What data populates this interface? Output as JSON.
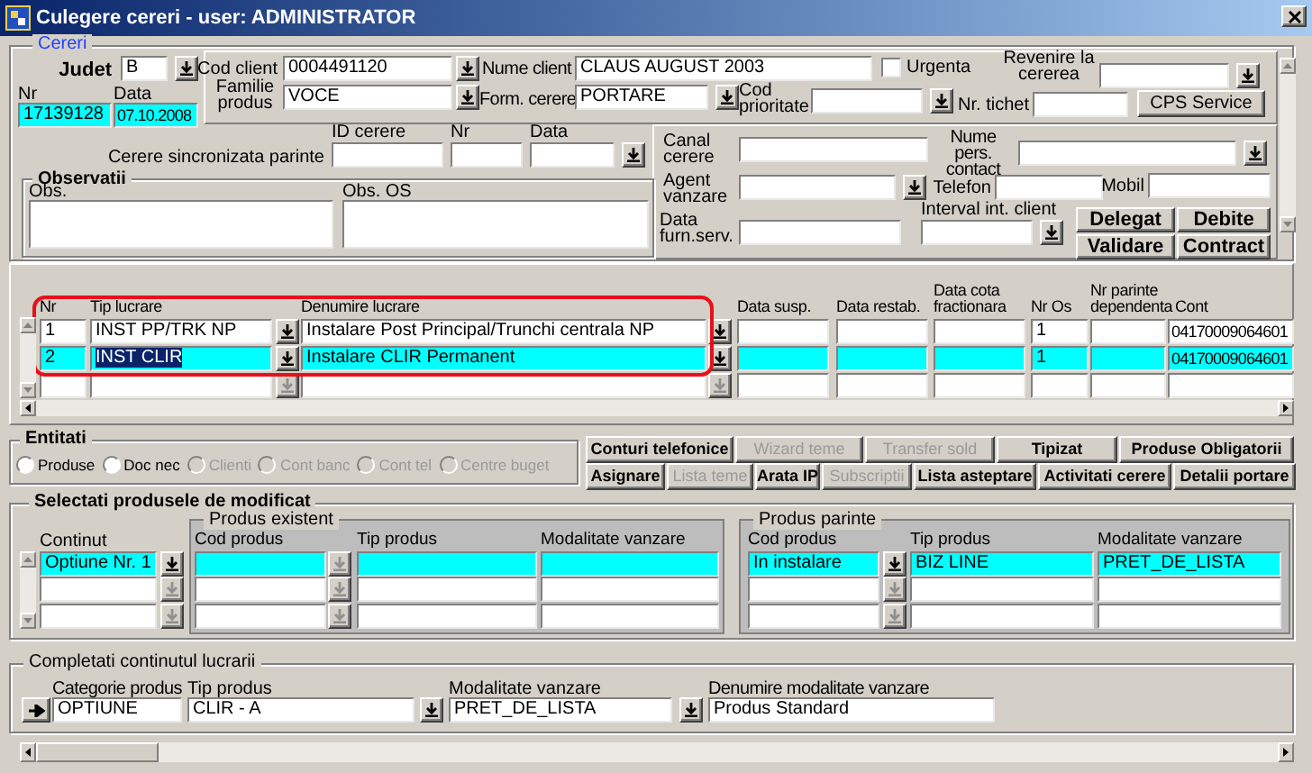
{
  "window": {
    "title": "Culegere cereri - user: ADMINISTRATOR"
  },
  "cereri": {
    "legend": "Cereri",
    "fields": [
      {
        "label": "Judet",
        "value": "B",
        "kind": "list",
        "highlighted": false
      },
      {
        "label": "Nr",
        "value": "17139128",
        "kind": "text",
        "highlighted": true
      },
      {
        "label": "Data",
        "value": "07.10.2008",
        "kind": "text",
        "highlighted": true
      },
      {
        "label": "Cod client",
        "value": "0004491120",
        "kind": "list",
        "highlighted": false
      },
      {
        "label": "Nume client",
        "value": "CLAUS AUGUST 2003",
        "kind": "text",
        "highlighted": false
      },
      {
        "label": "Revenire la cererea",
        "kind": "list",
        "highlighted": false
      },
      {
        "label": "Familie produs",
        "value": "VOCE",
        "kind": "list",
        "highlighted": false
      },
      {
        "label": "Form. cerere",
        "value": "PORTARE",
        "kind": "list",
        "highlighted": false
      },
      {
        "label": "Cod prioritate",
        "kind": "list",
        "highlighted": false
      },
      {
        "label": "Nr. tichet",
        "kind": "text",
        "highlighted": false
      },
      {
        "label": "ID cerere",
        "kind": "text",
        "highlighted": false
      },
      {
        "label": "Nr",
        "kind": "text",
        "highlighted": false
      },
      {
        "label": "Data",
        "kind": "list",
        "highlighted": false
      },
      {
        "label": "Canal cerere",
        "kind": "text",
        "highlighted": false
      },
      {
        "label": "Nume pers. contact",
        "kind": "list",
        "highlighted": false
      },
      {
        "label": "Agent vanzare",
        "kind": "list",
        "highlighted": false
      },
      {
        "label": "Telefon",
        "kind": "text",
        "highlighted": false
      },
      {
        "label": "Mobil",
        "kind": "text",
        "highlighted": false
      },
      {
        "label": "Data furn.serv.",
        "kind": "text",
        "highlighted": false
      },
      {
        "label": "Interval int. client",
        "kind": "list",
        "highlighted": false
      },
      {
        "label": "Obs.",
        "kind": "area",
        "highlighted": false
      },
      {
        "label": "Obs. OS",
        "kind": "area",
        "highlighted": false
      }
    ],
    "sync_label": "Cerere sincronizata parinte",
    "observatii_legend": "Observatii",
    "urgenta": {
      "label": "Urgenta",
      "checked": false
    },
    "buttons": [
      "CPS Service",
      "Delegat",
      "Debite",
      "Validare",
      "Contract"
    ]
  },
  "lucrari": {
    "columns": [
      "Nr",
      "Tip lucrare",
      "Denumire lucrare",
      "Data susp.",
      "Data restab.",
      "Data cota fractionara",
      "Nr Os",
      "Nr parinte dependenta",
      "Cont"
    ],
    "rows": [
      {
        "nr": "1",
        "tip_lucrare": "INST PP/TRK NP",
        "denumire_lucrare": "Instalare Post Principal/Trunchi centrala NP",
        "nr_os": "1",
        "cont": "04170009064601",
        "selected": false,
        "text_selected": false
      },
      {
        "nr": "2",
        "tip_lucrare": "INST CLIR",
        "denumire_lucrare": "Instalare CLIR Permanent",
        "nr_os": "1",
        "cont": "04170009064601",
        "selected": true,
        "text_selected": true
      },
      {
        "selected": false
      }
    ]
  },
  "entitati": {
    "legend": "Entitati",
    "options": [
      {
        "label": "Produse",
        "selected": false,
        "disabled": false
      },
      {
        "label": "Doc nec",
        "selected": false,
        "disabled": false
      },
      {
        "label": "Clienti",
        "selected": false,
        "disabled": true
      },
      {
        "label": "Cont banc",
        "selected": false,
        "disabled": true
      },
      {
        "label": "Cont tel",
        "selected": false,
        "disabled": true
      },
      {
        "label": "Centre buget",
        "selected": false,
        "disabled": true
      }
    ]
  },
  "actions": [
    {
      "label": "Conturi telefonice",
      "disabled": false
    },
    {
      "label": "Wizard teme",
      "disabled": true
    },
    {
      "label": "Transfer sold",
      "disabled": true
    },
    {
      "label": "Tipizat",
      "disabled": false
    },
    {
      "label": "Produse Obligatorii",
      "disabled": false
    },
    {
      "label": "Asignare",
      "disabled": false
    },
    {
      "label": "Lista teme",
      "disabled": true
    },
    {
      "label": "Arata IP",
      "disabled": false
    },
    {
      "label": "Subscriptii",
      "disabled": true
    },
    {
      "label": "Lista asteptare",
      "disabled": false
    },
    {
      "label": "Activitati cerere",
      "disabled": false
    },
    {
      "label": "Detalii portare",
      "disabled": false
    }
  ],
  "produse": {
    "legend": "Selectati produsele de modificat",
    "continut": {
      "header": "Continut",
      "rows": [
        {
          "value": "Optiune Nr. 1",
          "selected": true
        },
        {
          "selected": false
        },
        {
          "selected": false
        }
      ]
    },
    "existent": {
      "legend": "Produs existent",
      "columns": [
        "Cod produs",
        "Tip produs",
        "Modalitate vanzare"
      ],
      "rows": [
        {
          "selected": true
        },
        {
          "selected": false
        },
        {
          "selected": false
        }
      ]
    },
    "parinte": {
      "legend": "Produs parinte",
      "columns": [
        "Cod produs",
        "Tip produs",
        "Modalitate vanzare"
      ],
      "rows": [
        {
          "cod_produs": "In instalare",
          "tip_produs": "BIZ LINE",
          "modalitate_vanzare": "PRET_DE_LISTA",
          "selected": true
        },
        {
          "selected": false
        },
        {
          "selected": false
        }
      ]
    }
  },
  "completati": {
    "legend": "Completati continutul lucrarii",
    "fields": [
      {
        "label": "Categorie produs",
        "value": "OPTIUNE",
        "kind": "text"
      },
      {
        "label": "Tip produs",
        "value": "CLIR - A",
        "kind": "list"
      },
      {
        "label": "Modalitate vanzare",
        "value": "PRET_DE_LISTA",
        "kind": "list"
      },
      {
        "label": "Denumire modalitate vanzare",
        "value": "Produs Standard",
        "kind": "text"
      }
    ]
  }
}
